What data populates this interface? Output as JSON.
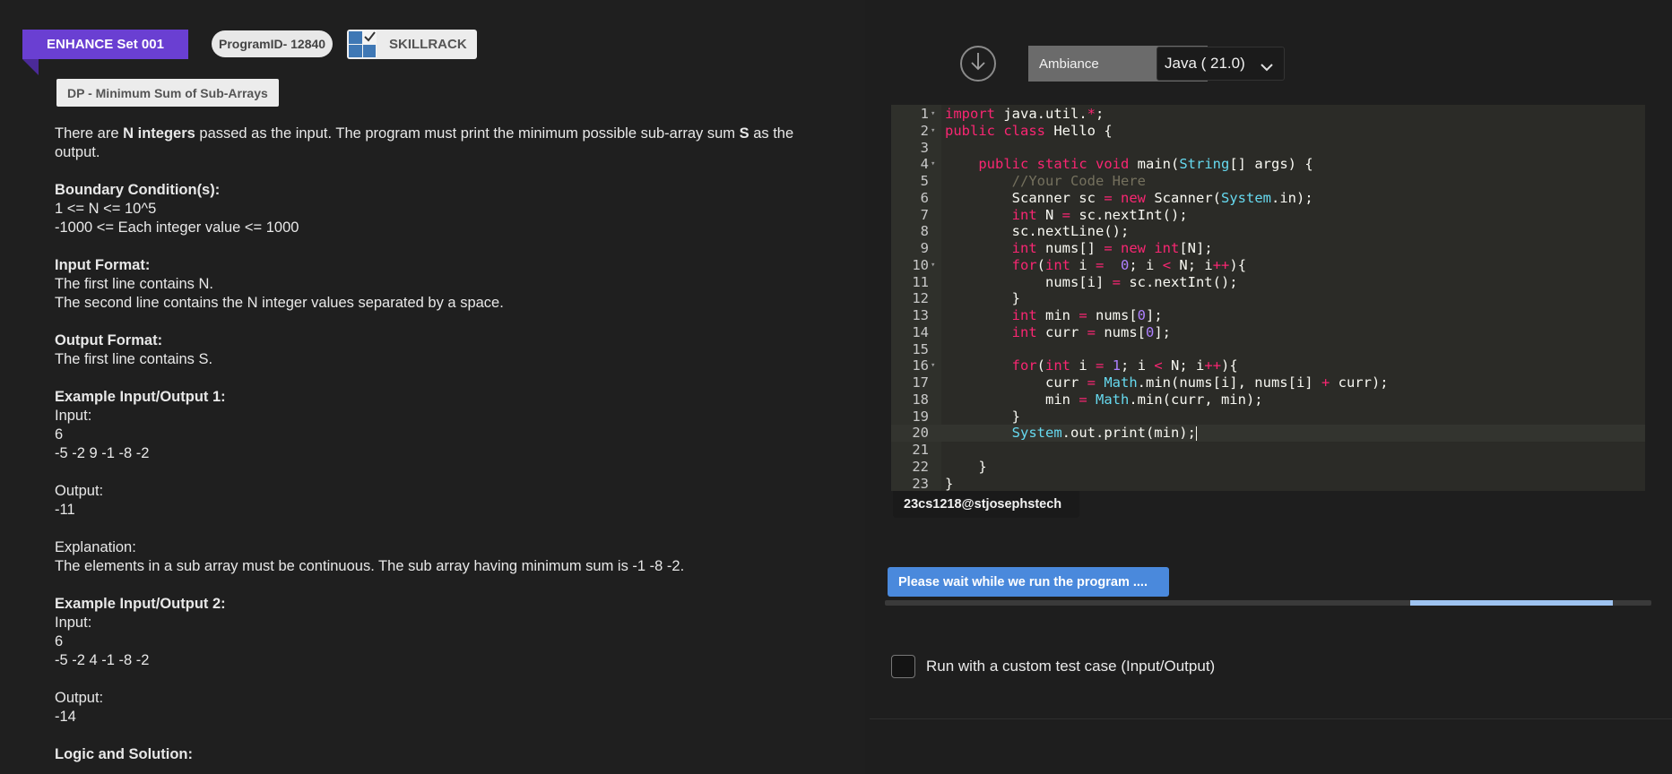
{
  "header": {
    "set_label": "ENHANCE Set 001",
    "program_id": "ProgramID- 12840",
    "brand": "SKILLRACK",
    "problem_title": "DP - Minimum Sum of Sub-Arrays"
  },
  "description": {
    "intro_1": "There are ",
    "intro_n": "N integers",
    "intro_2": " passed as the input. The program must print the minimum possible sub-array sum ",
    "intro_s": "S",
    "intro_3": " as the output.",
    "boundary_heading": "Boundary Condition(s):",
    "boundary_lines": [
      "1 <= N <= 10^5",
      "-1000 <= Each integer value <= 1000"
    ],
    "input_heading": "Input Format:",
    "input_lines": [
      "The first line contains N.",
      "The second line contains the N integer values separated by a space."
    ],
    "output_heading": "Output Format:",
    "output_lines": [
      "The first line contains S."
    ],
    "example1_heading": "Example Input/Output 1:",
    "example1_input_label": "Input:",
    "example1_input": [
      "6",
      "-5 -2 9 -1 -8 -2"
    ],
    "example1_output_label": "Output:",
    "example1_output": "-11",
    "explanation_label": "Explanation:",
    "explanation_text": "The elements in a sub array must be continuous. The sub array having minimum sum is -1 -8 -2.",
    "example2_heading": "Example Input/Output 2:",
    "example2_input_label": "Input:",
    "example2_input": [
      "6",
      "-5 -2 4 -1 -8 -2"
    ],
    "example2_output_label": "Output:",
    "example2_output": "-14",
    "logic_heading": "Logic and Solution:"
  },
  "toolbar": {
    "download_icon": "arrow-down-circle-icon",
    "theme": "Ambiance",
    "language": "Java ( 21.0)"
  },
  "editor": {
    "lines": [
      "import java.util.*;",
      "public class Hello {",
      "",
      "    public static void main(String[] args) {",
      "        //Your Code Here",
      "        Scanner sc = new Scanner(System.in);",
      "        int N = sc.nextInt();",
      "        sc.nextLine();",
      "        int nums[] = new int[N];",
      "        for(int i =  0; i < N; i++){",
      "            nums[i] = sc.nextInt();",
      "        }",
      "        int min = nums[0];",
      "        int curr = nums[0];",
      "",
      "        for(int i = 1; i < N; i++){",
      "            curr = Math.min(nums[i], nums[i] + curr);",
      "            min = Math.min(curr, min);",
      "        }",
      "        System.out.print(min);",
      "",
      "    }",
      "}"
    ],
    "fold_lines": [
      1,
      2,
      4,
      10,
      16
    ],
    "active_line": 20
  },
  "user": {
    "handle": "23cs1218@stjosephstech"
  },
  "run": {
    "status_text": "Please wait while we run the program ....",
    "progress_start": 0.685,
    "progress_end": 0.95
  },
  "custom_test": {
    "label": "Run with a custom test case (Input/Output)",
    "checked": false
  },
  "colors": {
    "ribbon": "#6a3fd2",
    "run_button": "#4a89dc",
    "progress": "#9ec3f0",
    "keyword": "#f92672",
    "type": "#66d9ef",
    "number": "#ae81ff",
    "comment": "#75715e"
  }
}
